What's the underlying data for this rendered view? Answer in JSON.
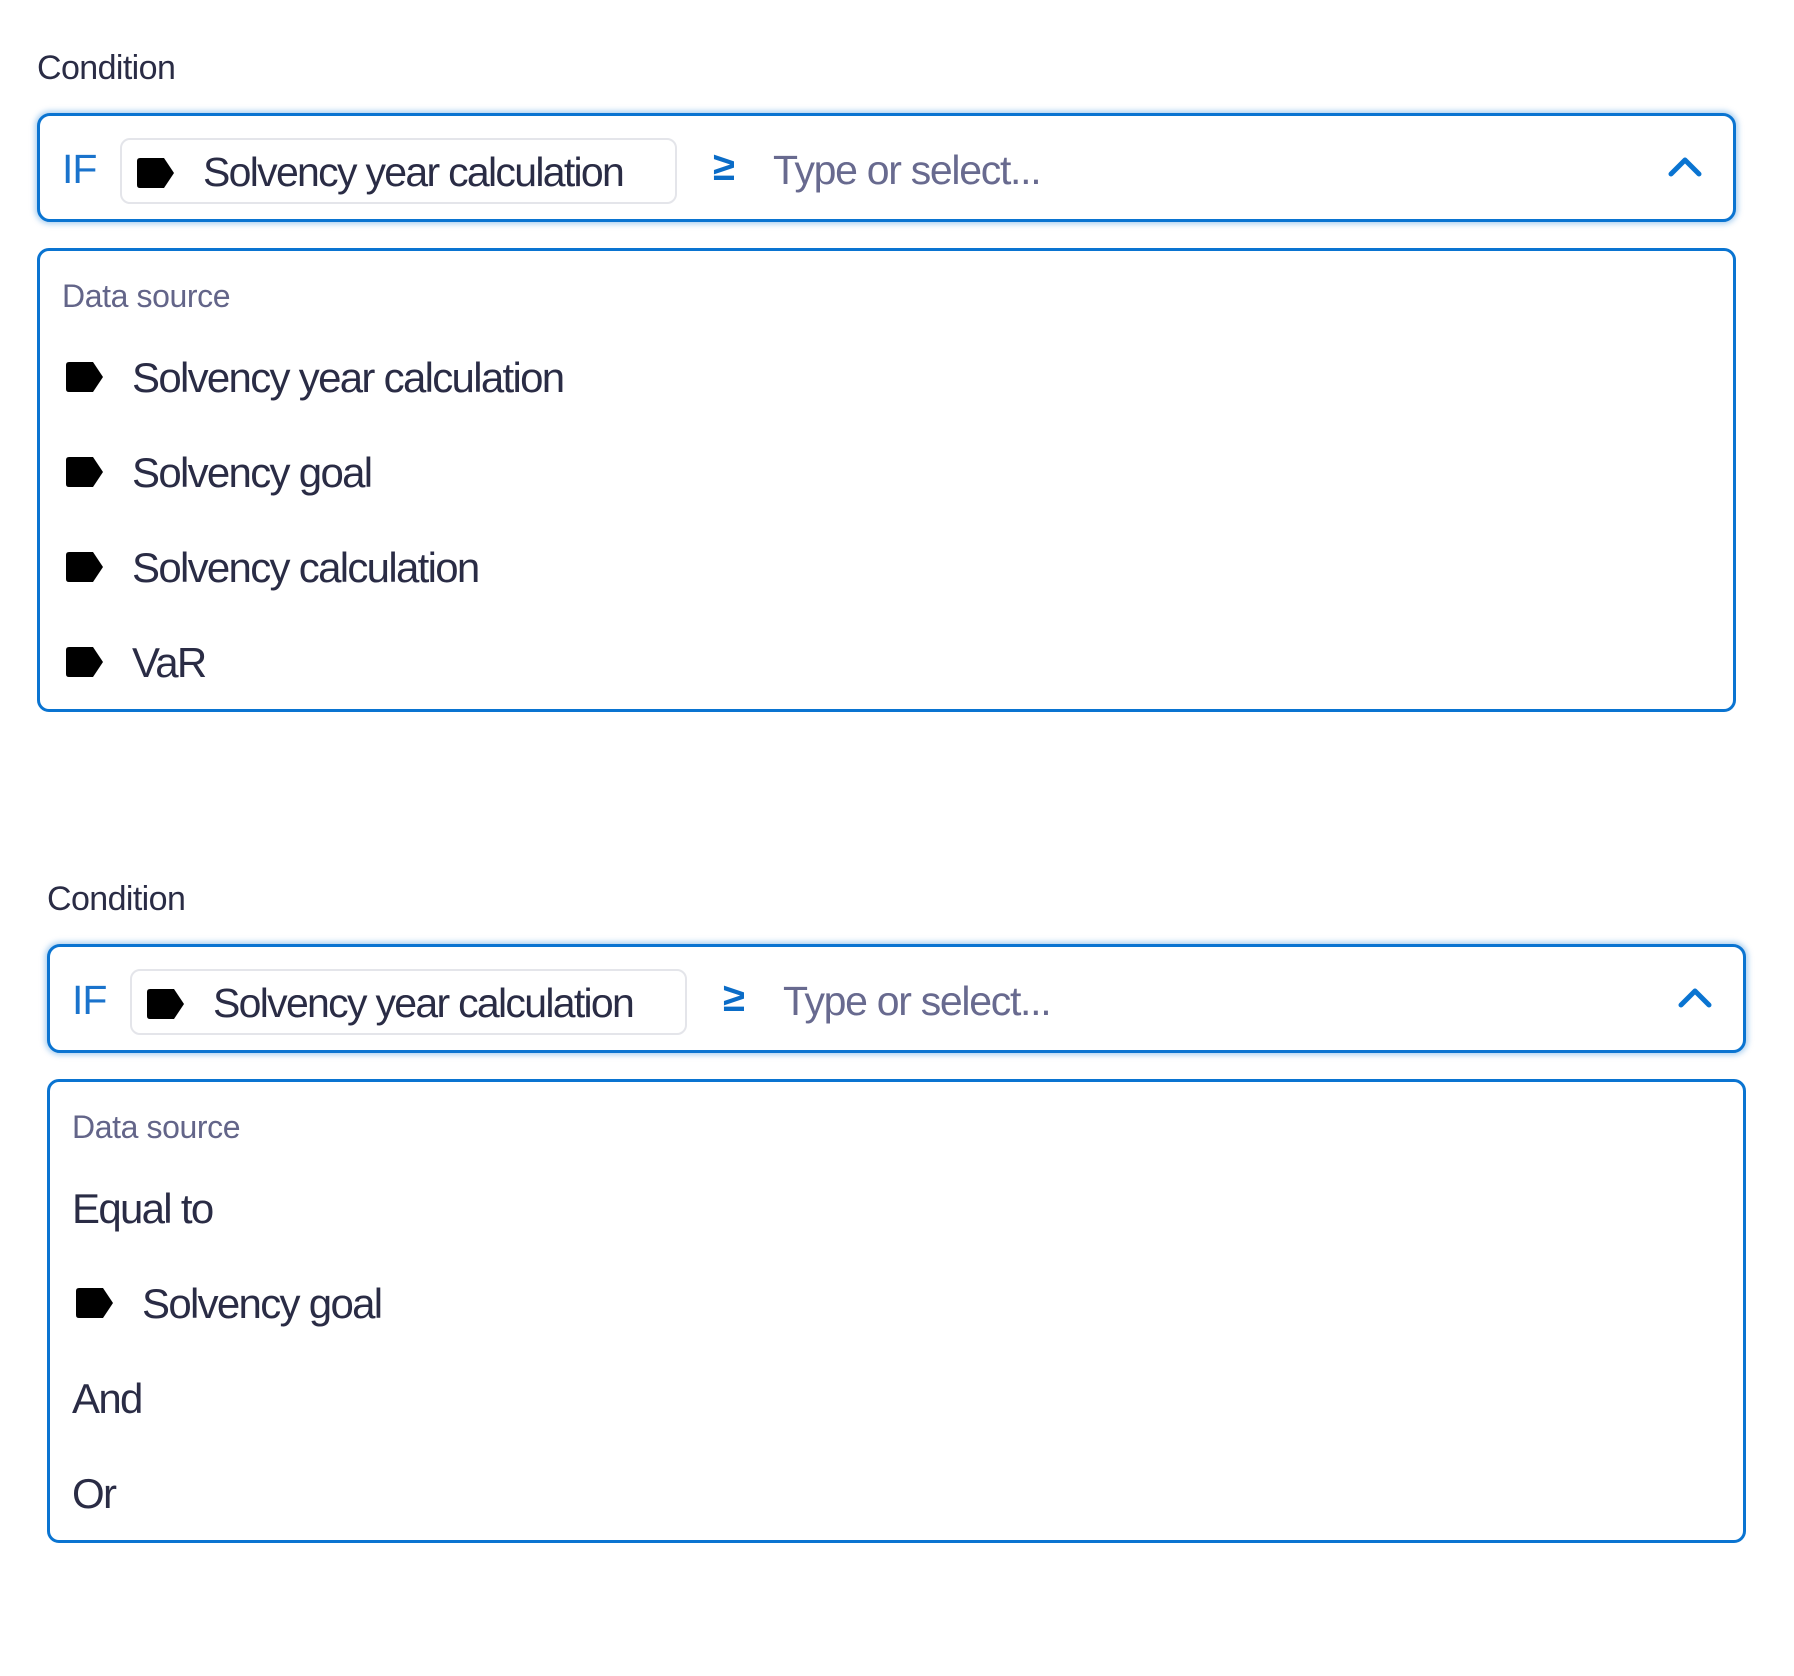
{
  "sections": [
    {
      "label": "Condition",
      "input": {
        "keyword": "IF",
        "chip": {
          "icon": "tag-icon",
          "label": "Solvency year calculation"
        },
        "operator": "≥",
        "placeholder": "Type or select...",
        "value": "",
        "toggle_icon": "chevron-up-icon",
        "expanded": true
      },
      "dropdown": {
        "header": "Data source",
        "options": [
          {
            "icon": "tag-icon",
            "label": "Solvency year calculation"
          },
          {
            "icon": "tag-icon",
            "label": "Solvency goal"
          },
          {
            "icon": "tag-icon",
            "label": "Solvency calculation"
          },
          {
            "icon": "tag-icon",
            "label": "VaR"
          }
        ]
      }
    },
    {
      "label": "Condition",
      "input": {
        "keyword": "IF",
        "chip": {
          "icon": "tag-icon",
          "label": "Solvency year calculation"
        },
        "operator": "≥",
        "placeholder": "Type or select...",
        "value": "",
        "toggle_icon": "chevron-up-icon",
        "expanded": true
      },
      "dropdown": {
        "header": "Data source",
        "options": [
          {
            "icon": null,
            "label": "Equal to"
          },
          {
            "icon": "tag-icon",
            "label": "Solvency goal"
          },
          {
            "icon": null,
            "label": "And"
          },
          {
            "icon": null,
            "label": "Or"
          }
        ]
      }
    }
  ],
  "colors": {
    "accent": "#0a74d1",
    "keyword": "#1a73cc",
    "text": "#2a2c45",
    "muted": "#636589",
    "chip_border": "#e4e5ea",
    "tag_icon": "#000000"
  }
}
